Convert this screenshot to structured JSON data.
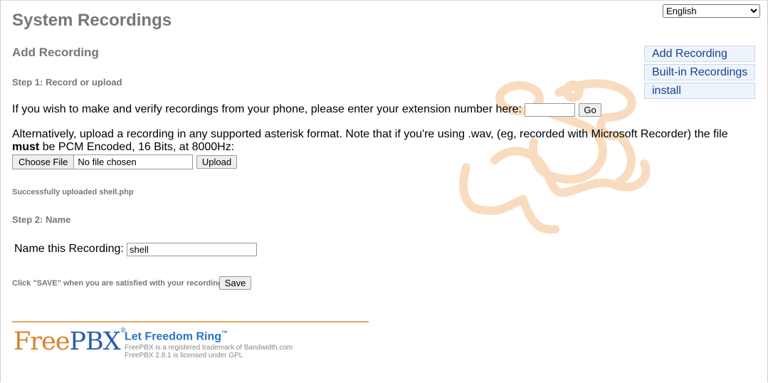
{
  "language": {
    "selected": "English"
  },
  "page": {
    "title": "System Recordings",
    "subtitle": "Add Recording"
  },
  "step1": {
    "label": "Step 1: Record or upload",
    "phone_text": "If you wish to make and verify recordings from your phone, please enter your extension number here:",
    "extension_value": "",
    "go_label": "Go",
    "upload_text_a": "Alternatively, upload a recording in any supported asterisk format. Note that if you're using .wav, (eg, recorded with Microsoft Recorder) the file",
    "upload_text_must": "must",
    "upload_text_b": "be PCM Encoded, 16 Bits, at 8000Hz:",
    "choose_file_label": "Choose File",
    "no_file_label": "No file chosen",
    "upload_label": "Upload",
    "status": "Successfully uploaded shell.php"
  },
  "step2": {
    "label": "Step 2: Name",
    "name_label": "Name this Recording:",
    "name_value": "shell",
    "save_hint": "Click \"SAVE\" when you are satisfied with your recording",
    "save_label": "Save"
  },
  "sidebar": {
    "items": [
      {
        "label": "Add Recording"
      },
      {
        "label": "Built-in Recordings"
      },
      {
        "label": "install"
      }
    ]
  },
  "footer": {
    "logo_free": "Free",
    "logo_pbx": "PBX",
    "logo_reg": "®",
    "tagline": "Let Freedom Ring",
    "tagline_tm": "™",
    "trademark": "FreePBX is a registered trademark of Bandwidth.com",
    "license": "FreePBX 2.8.1 is licensed under GPL"
  },
  "colors": {
    "accent_orange": "#e8a35a",
    "link_blue": "#1a3d8f",
    "heading_gray": "#777777"
  }
}
